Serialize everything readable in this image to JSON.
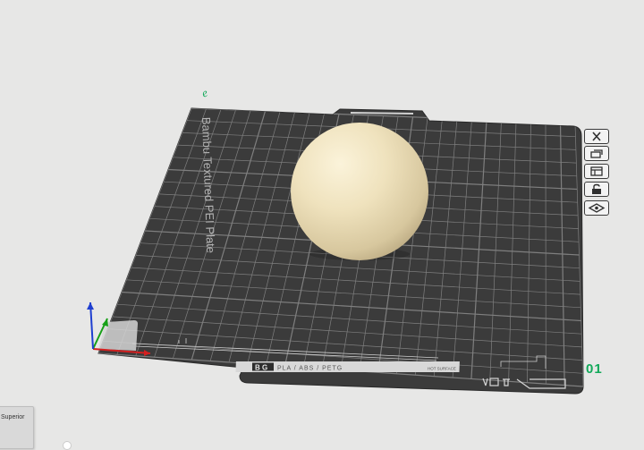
{
  "plate": {
    "name": "Bambu Textured PEI Plate",
    "number": "01",
    "tag": "e",
    "footer_code": "PLA / ABS / PETG",
    "footer_mark": "B G",
    "footer_small": "HOT SURFACE"
  },
  "view_cube": {
    "label": "Superior"
  },
  "toolbar": {
    "items": [
      {
        "name": "remove-all-button",
        "icon": "close-icon"
      },
      {
        "name": "arrange-button",
        "icon": "arrange-icon"
      },
      {
        "name": "orient-button",
        "icon": "orient-icon"
      },
      {
        "name": "lock-button",
        "icon": "lock-icon"
      },
      {
        "name": "settings-button",
        "icon": "eye-icon"
      }
    ]
  },
  "colors": {
    "background": "#e7e7e6",
    "plate": "#3b3b3b",
    "grid": "#8a8a8a",
    "model": "#efe2bd",
    "accent": "#12a95a",
    "axis_x": "#d42020",
    "axis_y": "#18a018",
    "axis_z": "#1f3fd0"
  }
}
